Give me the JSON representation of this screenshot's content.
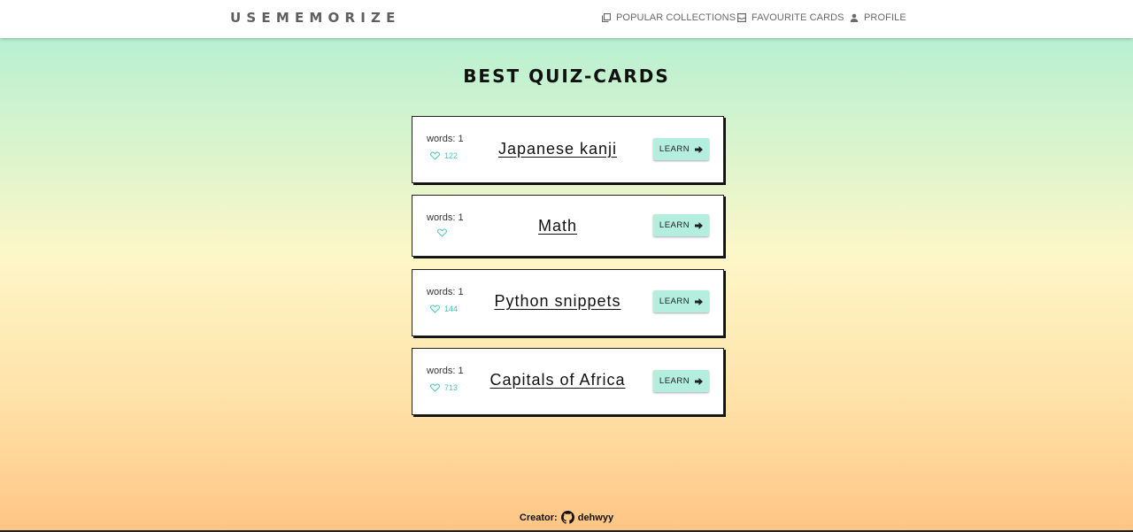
{
  "header": {
    "brand": "USEMEMORIZE",
    "nav": [
      {
        "label": "POPULAR COLLECTIONS",
        "icon": "collections-icon"
      },
      {
        "label": "FAVOURITE CARDS",
        "icon": "inbox-icon"
      },
      {
        "label": "PROFILE",
        "icon": "person-icon"
      }
    ]
  },
  "main": {
    "title": "BEST QUIZ-CARDS",
    "cards": [
      {
        "words": "words: 1",
        "likes": "122",
        "title": "Japanese kanji",
        "button": "LEARN"
      },
      {
        "words": "words: 1",
        "likes": "",
        "title": "Math",
        "button": "LEARN"
      },
      {
        "words": "words: 1",
        "likes": "144",
        "title": "Python snippets",
        "button": "LEARN"
      },
      {
        "words": "words: 1",
        "likes": "713",
        "title": "Capitals of Africa",
        "button": "LEARN"
      }
    ]
  },
  "footer": {
    "label": "Creator:",
    "icon": "github-icon",
    "author": "dehwyy"
  },
  "colors": {
    "accent": "#4cc7bc",
    "button_bg": "#b4eedf",
    "gradient_top": "#aeeed4",
    "gradient_middle": "#fdf7c8",
    "gradient_bottom": "#ffc585"
  }
}
